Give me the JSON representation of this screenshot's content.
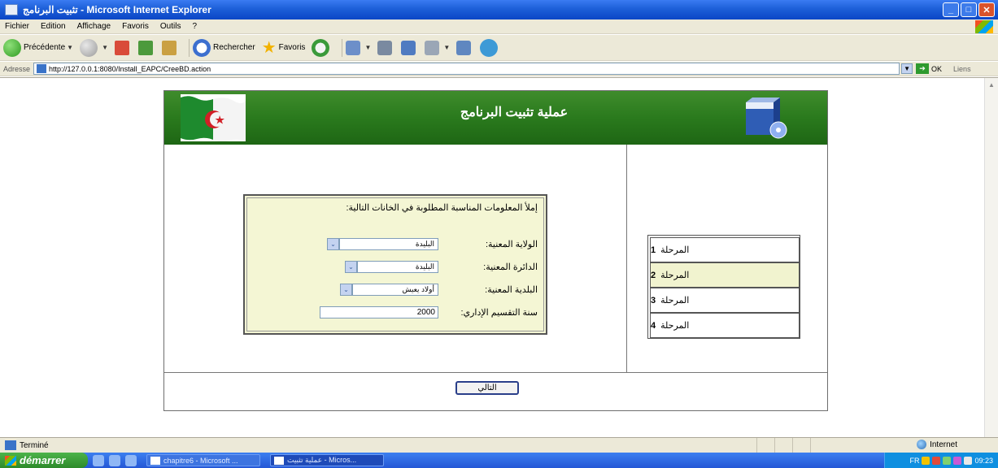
{
  "window": {
    "title": "تثبيت البرنامج - Microsoft Internet Explorer"
  },
  "menu": [
    "Fichier",
    "Edition",
    "Affichage",
    "Favoris",
    "Outils",
    "?"
  ],
  "toolbar": {
    "back_label": "Précédente",
    "search_label": "Rechercher",
    "favorites_label": "Favoris"
  },
  "address": {
    "label": "Adresse",
    "url": "http://127.0.0.1:8080/Install_EAPC/CreeBD.action",
    "go_label": "OK",
    "links_label": "Liens"
  },
  "page": {
    "banner_title": "عملية تثبيت البرنامج",
    "form": {
      "heading": "إملأ المعلومات المناسبة المطلوبة في الخانات التالية:",
      "fields": [
        {
          "label": "الولاية المعنية:",
          "value": "البليدة"
        },
        {
          "label": "الدائرة المعنية:",
          "value": "البليدة"
        },
        {
          "label": "البلدية المعنية:",
          "value": "أولاد يعيش"
        }
      ],
      "year_label": "سنة التقسيم الإداري:",
      "year_value": "2000"
    },
    "steps": [
      {
        "label": "المرحلة",
        "num": "1"
      },
      {
        "label": "المرحلة",
        "num": "2"
      },
      {
        "label": "المرحلة",
        "num": "3"
      },
      {
        "label": "المرحلة",
        "num": "4"
      }
    ],
    "active_step": 2,
    "next_button": "التالي"
  },
  "status": {
    "text": "Terminé",
    "zone": "Internet"
  },
  "taskbar": {
    "start_label": "démarrer",
    "tasks": [
      "chapitre6 - Microsoft ...",
      "عملية تثبيت - Micros..."
    ],
    "clock": "09:23",
    "lang": "FR"
  }
}
